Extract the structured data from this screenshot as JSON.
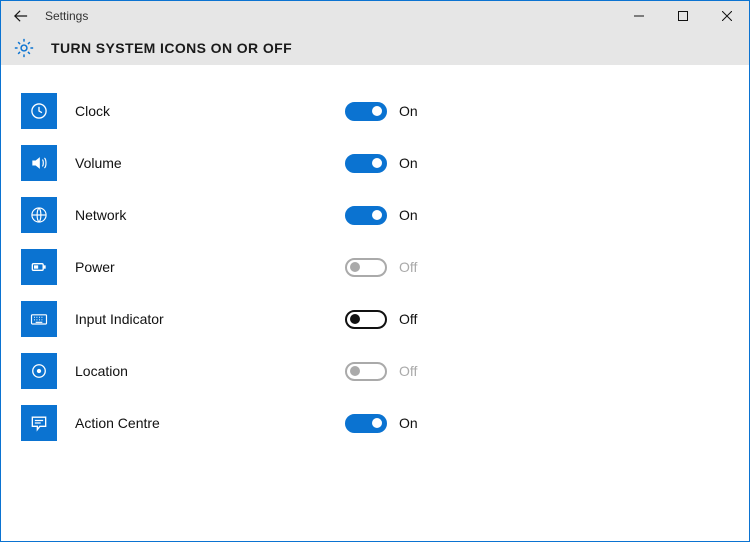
{
  "window": {
    "title": "Settings"
  },
  "page": {
    "title": "TURN SYSTEM ICONS ON OR OFF"
  },
  "labels": {
    "on": "On",
    "off": "Off"
  },
  "colors": {
    "accent": "#0b73d1"
  },
  "items": [
    {
      "icon": "clock-icon",
      "label": "Clock",
      "state": "on",
      "state_label": "On"
    },
    {
      "icon": "volume-icon",
      "label": "Volume",
      "state": "on",
      "state_label": "On"
    },
    {
      "icon": "network-icon",
      "label": "Network",
      "state": "on",
      "state_label": "On"
    },
    {
      "icon": "power-icon",
      "label": "Power",
      "state": "off-disabled",
      "state_label": "Off"
    },
    {
      "icon": "keyboard-icon",
      "label": "Input Indicator",
      "state": "off",
      "state_label": "Off"
    },
    {
      "icon": "location-icon",
      "label": "Location",
      "state": "off-disabled",
      "state_label": "Off"
    },
    {
      "icon": "action-centre-icon",
      "label": "Action Centre",
      "state": "on",
      "state_label": "On"
    }
  ]
}
